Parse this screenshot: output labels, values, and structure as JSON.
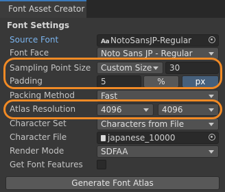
{
  "window": {
    "tab_title": "Font Asset Creator"
  },
  "section": {
    "title": "Font Settings"
  },
  "rows": {
    "source_font": {
      "label": "Source Font",
      "value": "NotoSansJP-Regular",
      "icon": "font-asset-icon"
    },
    "font_face": {
      "label": "Font Face",
      "value": "Noto Sans JP - Regular"
    },
    "sampling": {
      "label": "Sampling Point Size",
      "mode": "Custom Size",
      "size": "30"
    },
    "padding": {
      "label": "Padding",
      "value": "5",
      "unit_percent": "%",
      "unit_px": "px",
      "selected_unit": "px"
    },
    "packing": {
      "label": "Packing Method",
      "value": "Fast"
    },
    "atlas": {
      "label": "Atlas Resolution",
      "width": "4096",
      "height": "4096"
    },
    "charset": {
      "label": "Character Set",
      "value": "Characters from File"
    },
    "charfile": {
      "label": "Character File",
      "value": "japanese_10000"
    },
    "render": {
      "label": "Render Mode",
      "value": "SDFAA"
    },
    "features": {
      "label": "Get Font Features",
      "checked": false
    }
  },
  "generate_button": {
    "label": "Generate Font Atlas"
  },
  "colors": {
    "background": "#383838",
    "accent_blue": "#7bb4ee",
    "highlight_orange": "#f18a25",
    "selected_toggle": "#46607c"
  }
}
